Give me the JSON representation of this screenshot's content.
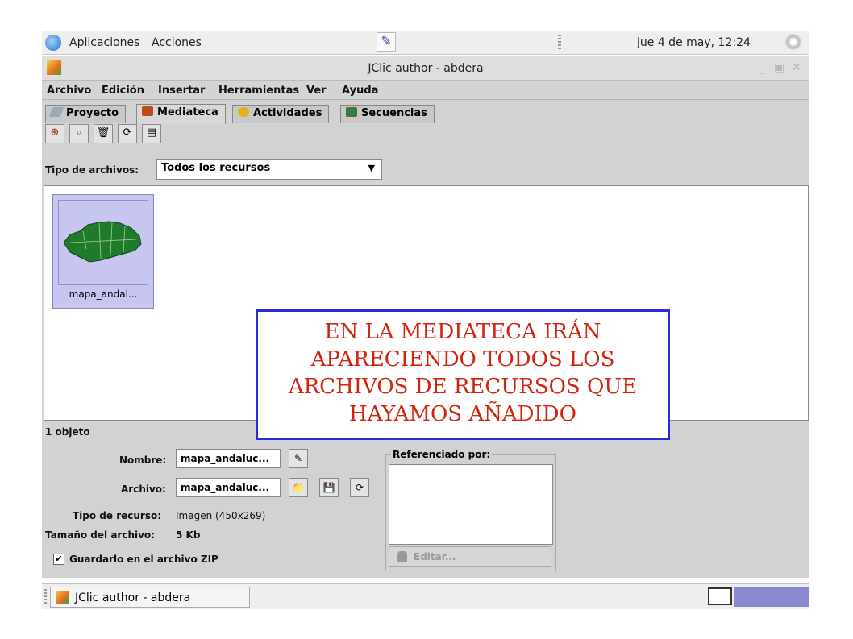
{
  "top_panel": {
    "applications": "Aplicaciones",
    "actions": "Acciones",
    "clock": "jue  4 de may, 12:24"
  },
  "window": {
    "title": "JClic author - abdera"
  },
  "menu": [
    "Archivo",
    "Edición",
    "Insertar",
    "Herramientas",
    "Ver",
    "Ayuda"
  ],
  "tabs": [
    "Proyecto",
    "Mediateca",
    "Actividades",
    "Secuencias"
  ],
  "filter": {
    "label": "Tipo de archivos:",
    "value": "Todos los recursos"
  },
  "media_item": {
    "label": "mapa_andal..."
  },
  "annotation": [
    "EN LA MEDIATECA IRÁN",
    "APARECIENDO TODOS LOS",
    "ARCHIVOS DE RECURSOS QUE",
    "HAYAMOS AÑADIDO"
  ],
  "details": {
    "count": "1 objeto",
    "name_label": "Nombre:",
    "name_value": "mapa_andaluc...",
    "file_label": "Archivo:",
    "file_value": "mapa_andaluc...",
    "type_label": "Tipo de recurso:",
    "type_value": "Imagen (450x269)",
    "size_label": "Tamaño del archivo:",
    "size_value": "5 Kb",
    "zip_label": "Guardarlo en el archivo ZIP",
    "referenced_label": "Referenciado por:",
    "edit_label": "Editar..."
  },
  "taskbar": {
    "task": "JClic author - abdera"
  },
  "colors": {
    "annotation_text": "#d02410",
    "annotation_border": "#2a2adf",
    "tile_bg": "#c6c6f0",
    "map_green": "#1f7a2c"
  }
}
